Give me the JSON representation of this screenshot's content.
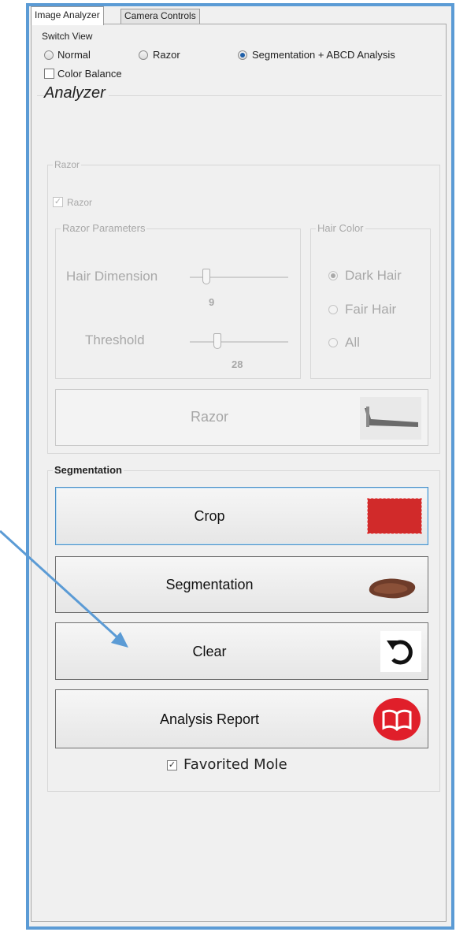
{
  "tabs": {
    "active": "Image Analyzer",
    "inactive": "Camera Controls"
  },
  "switch_view": {
    "label": "Switch View",
    "options": [
      "Normal",
      "Razor",
      "Segmentation + ABCD Analysis"
    ],
    "selected": "Segmentation + ABCD Analysis",
    "color_balance_label": "Color Balance",
    "color_balance_checked": false
  },
  "analyzer": {
    "title": "Analyzer",
    "razor_group": {
      "label": "Razor",
      "razor_checkbox_label": "Razor",
      "razor_checked": true,
      "params_label": "Razor Parameters",
      "hair_dimension_label": "Hair Dimension",
      "hair_dimension_value": "9",
      "threshold_label": "Threshold",
      "threshold_value": "28",
      "hair_color_label": "Hair Color",
      "hair_color_options": [
        "Dark Hair",
        "Fair Hair",
        "All"
      ],
      "hair_color_selected": "Dark Hair",
      "razor_button_label": "Razor"
    },
    "segmentation_group": {
      "label": "Segmentation",
      "crop_label": "Crop",
      "segmentation_label": "Segmentation",
      "clear_label": "Clear",
      "analysis_report_label": "Analysis Report",
      "favorited_label": "Favorited Mole",
      "favorited_checked": true
    }
  },
  "colors": {
    "frame_border": "#5b9bd5",
    "crop_icon": "#d12a2a",
    "report_icon": "#e01f2a",
    "arrow": "#5b9bd5"
  }
}
